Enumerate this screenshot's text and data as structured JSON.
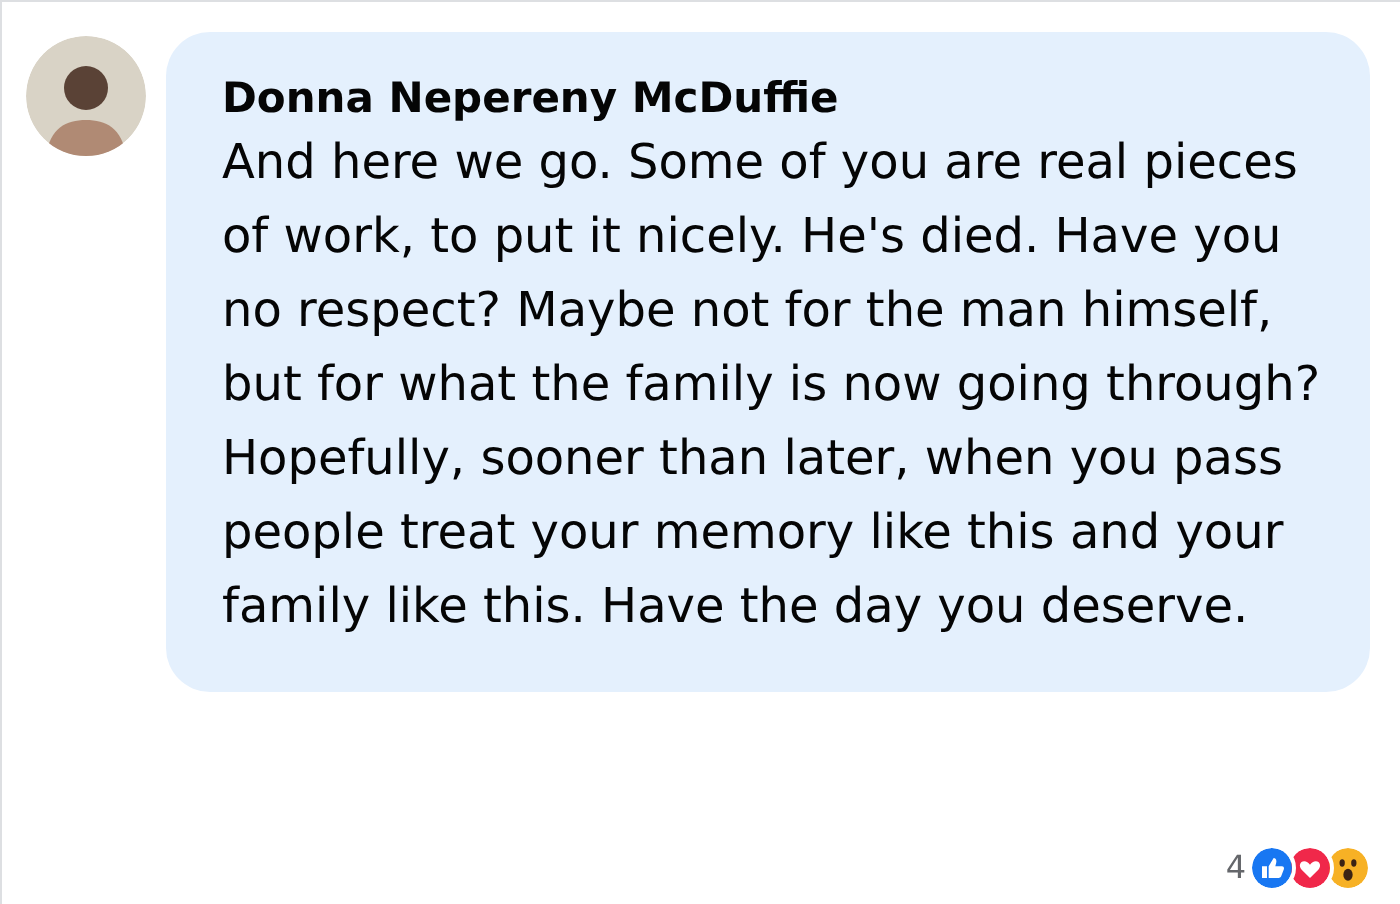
{
  "comment": {
    "author": "Donna Nepereny McDuffie",
    "text": "And here we go. Some of you are real pieces of work, to put it nicely. He's died. Have you no respect? Maybe not for the man himself, but for what the family is now going through? Hopefully, sooner than later, when you pass people treat your memory like this and your family like this. Have the day you deserve."
  },
  "reactions": {
    "count": "4",
    "types": [
      {
        "kind": "like"
      },
      {
        "kind": "love"
      },
      {
        "kind": "wow"
      }
    ]
  }
}
